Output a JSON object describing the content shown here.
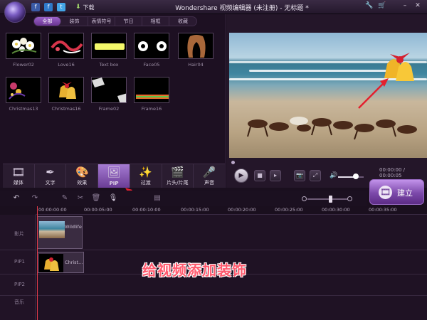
{
  "titlebar": {
    "download_label": "下载",
    "window_title": "Wondershare 视频编辑器 (未注册) - 无标题 *",
    "controls": [
      "🔧",
      "🛒",
      "–",
      "✕"
    ]
  },
  "categories": {
    "tabs": [
      "全部",
      "装饰",
      "表情符号",
      "节日",
      "相框",
      "收藏"
    ],
    "active_index": 0
  },
  "library": {
    "items": [
      {
        "label": "Flower02",
        "icon": "flower-thumbnail"
      },
      {
        "label": "Love16",
        "icon": "love-thumbnail"
      },
      {
        "label": "Text box",
        "icon": "textbox-thumbnail"
      },
      {
        "label": "Face05",
        "icon": "face-thumbnail"
      },
      {
        "label": "Hair04",
        "icon": "hair-thumbnail"
      },
      {
        "label": "Christmas13",
        "icon": "christmas-thumbnail"
      },
      {
        "label": "Christmas16",
        "icon": "bells-thumbnail"
      },
      {
        "label": "Frame02",
        "icon": "frame-thumbnail"
      },
      {
        "label": "Frame16",
        "icon": "frame-thumbnail"
      }
    ]
  },
  "tools": [
    {
      "label": "媒体",
      "icon": "🎞"
    },
    {
      "label": "文字",
      "icon": "✒"
    },
    {
      "label": "效果",
      "icon": "🎨"
    },
    {
      "label": "PIP",
      "icon": "🖼"
    },
    {
      "label": "过渡",
      "icon": "✨"
    },
    {
      "label": "片头/片尾",
      "icon": "🎬"
    },
    {
      "label": "声音",
      "icon": "🎤"
    }
  ],
  "active_tool": "PIP",
  "player": {
    "timecode": "00:00:00 / 00:00:05",
    "play_icon": "▶",
    "stop_icon": "■",
    "next_icon": "▸",
    "snapshot_icon": "📷",
    "fullscreen_icon": "⤢",
    "volume_icon": "🔊",
    "volume_level": 0.7
  },
  "build_button": {
    "label": "建立",
    "icon": "🎞"
  },
  "timeline": {
    "ruler": [
      "00:00:00:00",
      "00:00:05:00",
      "00:00:10:00",
      "00:00:15:00",
      "00:00:20:00",
      "00:00:25:00",
      "00:00:30:00",
      "00:00:35:00"
    ],
    "tracks": [
      "影片",
      "PIP1",
      "PIP2",
      "音乐"
    ],
    "video_clip_label": "Wildlife",
    "pip_clip_label": "Christ..."
  },
  "annotation": "给视频添加装饰",
  "colors": {
    "accent": "#7c49aa",
    "annotation": "#ff5a6e",
    "playhead": "#e23b4a"
  }
}
